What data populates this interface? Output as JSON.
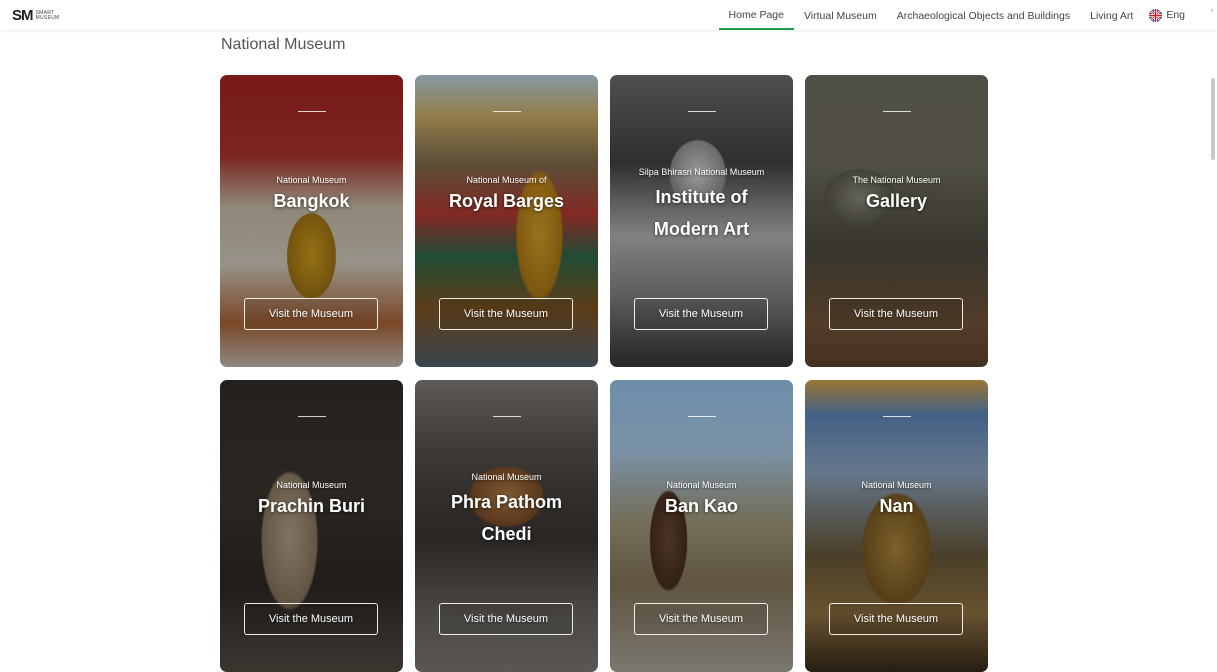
{
  "header": {
    "logo_mark": "SM",
    "logo_line1": "SMART",
    "logo_line2": "MUSEUM",
    "nav": [
      {
        "label": "Home Page",
        "active": true
      },
      {
        "label": "Virtual Museum",
        "active": false
      },
      {
        "label": "Archaeological Objects and Buildings",
        "active": false
      },
      {
        "label": "Living Art",
        "active": false
      }
    ],
    "language": {
      "label": "Eng",
      "icon": "uk-flag-icon"
    },
    "accent_color": "#1f9d4a"
  },
  "page": {
    "title": "National Museum"
  },
  "museums": [
    {
      "subtitle": "National Museum",
      "name": "Bangkok",
      "button": "Visit the Museum"
    },
    {
      "subtitle": "National Museum of",
      "name": "Royal Barges",
      "button": "Visit the Museum"
    },
    {
      "subtitle": "Silpa Bhirasri National Museum",
      "name": "Institute of Modern Art",
      "button": "Visit the Museum"
    },
    {
      "subtitle": "The National Museum",
      "name": "Gallery",
      "button": "Visit the Museum"
    },
    {
      "subtitle": "National Museum",
      "name": "Prachin Buri",
      "button": "Visit the Museum"
    },
    {
      "subtitle": "National Museum",
      "name": "Phra Pathom Chedi",
      "button": "Visit the Museum"
    },
    {
      "subtitle": "National Museum",
      "name": "Ban Kao",
      "button": "Visit the Museum"
    },
    {
      "subtitle": "National Museum",
      "name": "Nan",
      "button": "Visit the Museum"
    }
  ]
}
